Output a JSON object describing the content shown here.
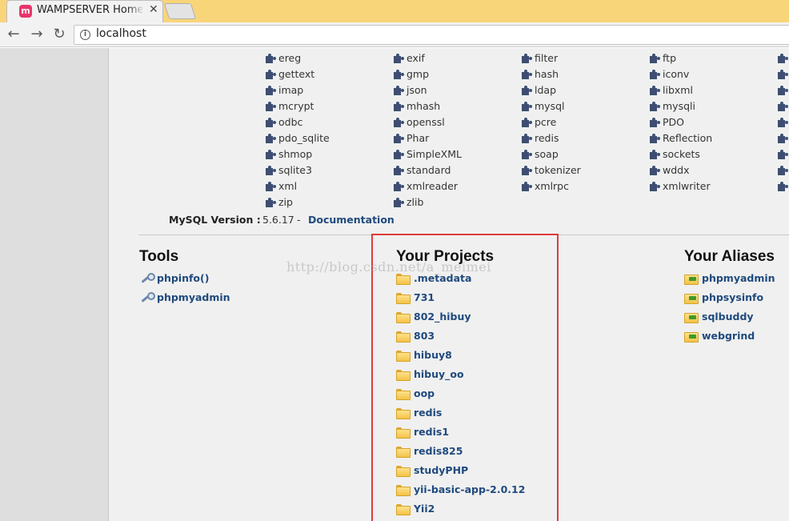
{
  "browser": {
    "tab_title": "WAMPSERVER Homepage",
    "tab_favicon": "m",
    "close_glyph": "✕",
    "url": "localhost",
    "back_glyph": "←",
    "forward_glyph": "→",
    "reload_glyph": "↻",
    "info_glyph": "i"
  },
  "extensions": [
    [
      "ereg",
      "exif",
      "filter",
      "ftp"
    ],
    [
      "gettext",
      "gmp",
      "hash",
      "iconv"
    ],
    [
      "imap",
      "json",
      "ldap",
      "libxml"
    ],
    [
      "mcrypt",
      "mhash",
      "mysql",
      "mysqli"
    ],
    [
      "odbc",
      "openssl",
      "pcre",
      "PDO"
    ],
    [
      "pdo_sqlite",
      "Phar",
      "redis",
      "Reflection"
    ],
    [
      "shmop",
      "SimpleXML",
      "soap",
      "sockets"
    ],
    [
      "sqlite3",
      "standard",
      "tokenizer",
      "wddx"
    ],
    [
      "xml",
      "xmlreader",
      "xmlrpc",
      "xmlwriter"
    ],
    [
      "zip",
      "zlib"
    ]
  ],
  "mysql": {
    "label": "MySQL Version :",
    "version": "5.6.17",
    "separator": "-",
    "doc_link": "Documentation"
  },
  "tools": {
    "title": "Tools",
    "items": [
      "phpinfo()",
      "phpmyadmin"
    ]
  },
  "projects": {
    "title": "Your Projects",
    "items": [
      ".metadata",
      "731",
      "802_hibuy",
      "803",
      "hibuy8",
      "hibuy_oo",
      "oop",
      "redis",
      "redis1",
      "redis825",
      "studyPHP",
      "yii-basic-app-2.0.12",
      "Yii2"
    ]
  },
  "aliases": {
    "title": "Your Aliases",
    "items": [
      "phpmyadmin",
      "phpsysinfo",
      "sqlbuddy",
      "webgrind"
    ]
  },
  "watermark": "http://blog.csdn.net/a_meimei",
  "colors": {
    "highlight": "#e03b3b",
    "link": "#1f4a7d",
    "tabstrip": "#f9d57a"
  }
}
